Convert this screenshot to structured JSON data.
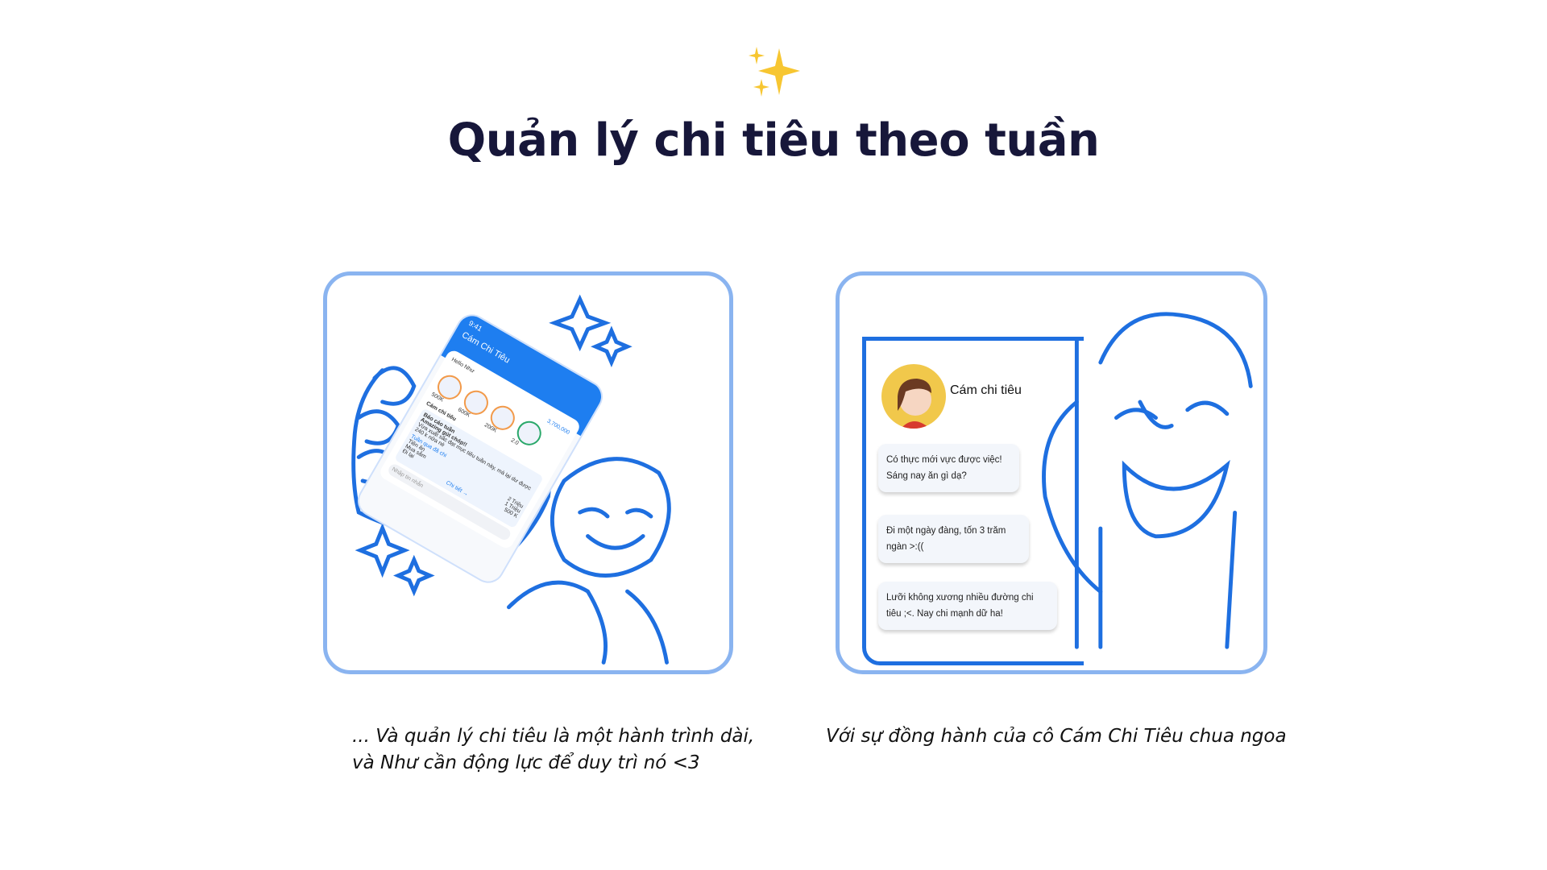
{
  "header": {
    "sparkle_icon": "sparkles-icon",
    "title": "Quản lý chi tiêu theo tuần"
  },
  "left_card": {
    "phone": {
      "time": "9:41",
      "app_title": "Cám Chi Tiêu",
      "greeting": "Hello Như",
      "balance": "3,700,000",
      "categories": [
        "500K",
        "600K",
        "200K",
        "2.0"
      ],
      "bot_name": "Cám chi tiêu",
      "report_title": "Báo cáo tuần",
      "report_headline": "Amazing gút chóp!!",
      "report_text": "Vừa xuất sắc đạt mục tiêu tuần này, mà lại dư được 240 k nữa nè",
      "last_week_label": "Tuần qua đã chi",
      "spend_items": [
        {
          "label": "Tiền ăn",
          "amount": "2 Triệu"
        },
        {
          "label": "Mua sắm",
          "amount": "1 Triệu"
        },
        {
          "label": "Đi lại",
          "amount": "500 K"
        }
      ],
      "detail_link": "Chi tiết →",
      "input_placeholder": "Nhập tin nhắn"
    }
  },
  "right_card": {
    "bot_name": "Cám chi tiêu",
    "messages": [
      "Có thực mới vực được việc! Sáng nay ăn gì dạ?",
      "Đi một ngày đàng, tốn 3 trăm ngàn >:((",
      "Lưỡi không xương nhiều đường chi tiêu ;<. Nay chi mạnh dữ ha!"
    ]
  },
  "captions": {
    "left_line1": "... Và quản lý chi tiêu là một hành trình dài,",
    "left_line2": "và Như cần động lực để duy trì nó <3",
    "right": "Với sự đồng hành của cô Cám Chi Tiêu chua ngoa"
  },
  "colors": {
    "accent": "#1e7ef0",
    "card_border": "#8ab4f0",
    "title": "#17173a"
  }
}
